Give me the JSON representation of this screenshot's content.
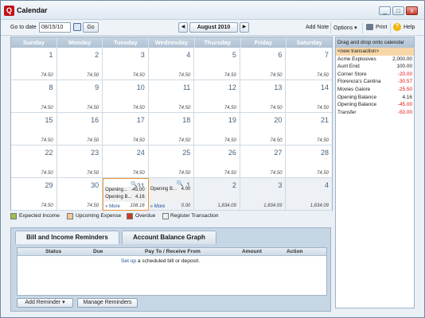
{
  "window": {
    "title": "Calendar",
    "app_icon": "Q",
    "buttons": [
      "_",
      "□",
      "x"
    ]
  },
  "toolbar": {
    "goto_label": "Go to date",
    "goto_value": "08/15/10",
    "go_label": "Go",
    "prev_label": "◀",
    "month_label": "August 2010",
    "next_label": "▶",
    "add_note_label": "Add Note",
    "options_label": "Options ▾",
    "print_label": "Print",
    "help_label": "Help"
  },
  "calendar": {
    "weekdays": [
      "Sunday",
      "Monday",
      "Tuesday",
      "Wednesday",
      "Thursday",
      "Friday",
      "Saturday"
    ],
    "cells": [
      {
        "day": "1",
        "bal": "74.50"
      },
      {
        "day": "2",
        "bal": "74.50"
      },
      {
        "day": "3",
        "bal": "74.50"
      },
      {
        "day": "4",
        "bal": "74.50"
      },
      {
        "day": "5",
        "bal": "74.50"
      },
      {
        "day": "6",
        "bal": "74.50"
      },
      {
        "day": "7",
        "bal": "74.50"
      },
      {
        "day": "8",
        "bal": "74.50"
      },
      {
        "day": "9",
        "bal": "74.50"
      },
      {
        "day": "10",
        "bal": "74.50"
      },
      {
        "day": "11",
        "bal": "74.50"
      },
      {
        "day": "12",
        "bal": "74.50"
      },
      {
        "day": "13",
        "bal": "74.50"
      },
      {
        "day": "14",
        "bal": "74.50"
      },
      {
        "day": "15",
        "bal": "74.50"
      },
      {
        "day": "16",
        "bal": "74.50"
      },
      {
        "day": "17",
        "bal": "74.50"
      },
      {
        "day": "18",
        "bal": "74.50"
      },
      {
        "day": "19",
        "bal": "74.50"
      },
      {
        "day": "20",
        "bal": "74.50"
      },
      {
        "day": "21",
        "bal": "74.50"
      },
      {
        "day": "22",
        "bal": "74.50"
      },
      {
        "day": "23",
        "bal": "74.50"
      },
      {
        "day": "24",
        "bal": "74.50"
      },
      {
        "day": "25",
        "bal": "74.50"
      },
      {
        "day": "26",
        "bal": "74.50"
      },
      {
        "day": "27",
        "bal": "74.50"
      },
      {
        "day": "28",
        "bal": "74.50"
      },
      {
        "day": "29",
        "bal": "74.50"
      },
      {
        "day": "30",
        "bal": "74.50"
      },
      {
        "day": "31",
        "bal": "108.16"
      },
      {
        "day": "1",
        "bal": "0.00"
      },
      {
        "day": "2",
        "bal": "1,834.09"
      },
      {
        "day": "3",
        "bal": "1,834.09"
      },
      {
        "day": "4",
        "bal": "1,834.09"
      }
    ],
    "today_tx": [
      {
        "name": "Opening...",
        "amt": "-45.00"
      },
      {
        "name": "Opening B...",
        "amt": "4.16"
      }
    ],
    "next_tx": [
      {
        "name": "Opening B...",
        "amt": "4.00"
      }
    ],
    "more_label": "» More"
  },
  "legend": {
    "items": [
      {
        "label": "Expected Income",
        "color": "#9bbf52"
      },
      {
        "label": "Upcoming Expense",
        "color": "#f4c99a"
      },
      {
        "label": "Overdue",
        "color": "#c83c1c"
      },
      {
        "label": "Register Transaction",
        "color": "#f0f0f0"
      }
    ]
  },
  "right_panel": {
    "header": "Drag and drop onto calendar",
    "rows": [
      {
        "name": "<new transaction>",
        "amount": ""
      },
      {
        "name": "Acme Explosives",
        "amount": "2,000.00"
      },
      {
        "name": "Aunt Enid",
        "amount": "100.00"
      },
      {
        "name": "Corner Store",
        "amount": "-20.00"
      },
      {
        "name": "Florencia's Cantina",
        "amount": "-30.57"
      },
      {
        "name": "Movies Galore",
        "amount": "-25.50"
      },
      {
        "name": "Opening Balance",
        "amount": "4.16"
      },
      {
        "name": "Opening Balance",
        "amount": "-45.00"
      },
      {
        "name": "Transfer",
        "amount": "-50.00"
      }
    ]
  },
  "reminders": {
    "tab_bills": "Bill and Income Reminders",
    "tab_graph": "Account Balance Graph",
    "columns": [
      "Status",
      "Due",
      "Pay To / Receive From",
      "Amount",
      "Action"
    ],
    "link_text": "Set up",
    "message_tail": " a scheduled bill or deposit.",
    "add_label": "Add Reminder ▾",
    "manage_label": "Manage Reminders"
  }
}
